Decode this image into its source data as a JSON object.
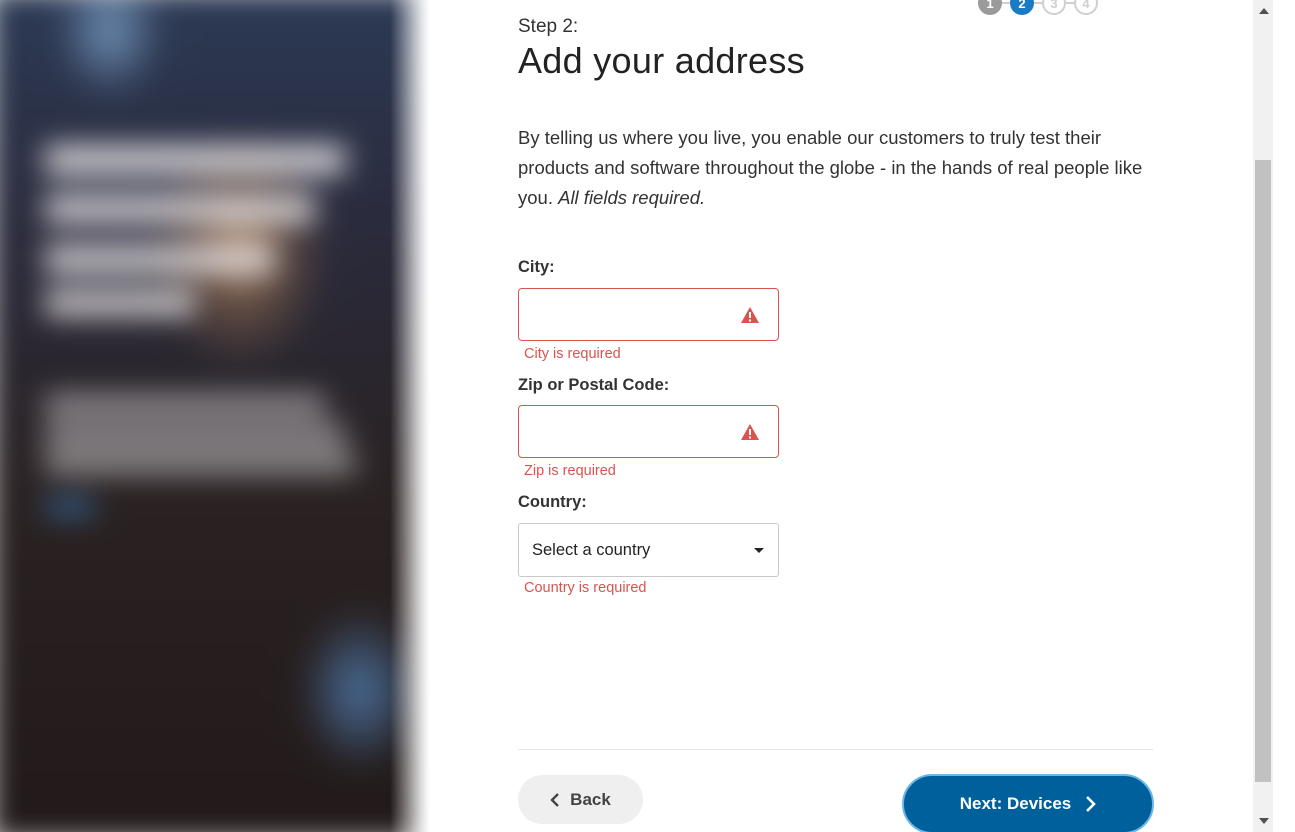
{
  "stepper": {
    "steps": [
      {
        "label": "1",
        "state": "done"
      },
      {
        "label": "2",
        "state": "active"
      },
      {
        "label": "3",
        "state": "todo"
      },
      {
        "label": "4",
        "state": "todo"
      }
    ]
  },
  "header": {
    "step_label": "Step 2:",
    "title": "Add your address"
  },
  "intro": {
    "text": "By telling us where you live, you enable our customers to truly test their products and software throughout the globe - in the hands of real people like you.",
    "required_note": "All fields required."
  },
  "form": {
    "city": {
      "label": "City:",
      "value": "",
      "error": "City is required"
    },
    "zip": {
      "label": "Zip or Postal Code:",
      "value": "",
      "error": "Zip is required"
    },
    "country": {
      "label": "Country:",
      "selected": "Select a country",
      "error": "Country is required"
    }
  },
  "nav": {
    "back_label": "Back",
    "next_label": "Next: Devices"
  },
  "colors": {
    "error": "#d9534f",
    "primary": "#00609c",
    "active_step": "#1a7bc4"
  }
}
